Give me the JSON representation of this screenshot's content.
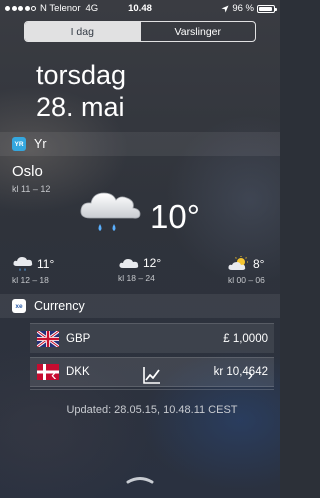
{
  "status_bar": {
    "carrier": "N Telenor",
    "network": "4G",
    "time": "10.48",
    "battery_percent": "96 %",
    "battery_level": 0.96
  },
  "tabs": [
    {
      "label": "I dag",
      "active": true
    },
    {
      "label": "Varslinger",
      "active": false
    }
  ],
  "today": {
    "weekday": "torsdag",
    "date": "28. mai"
  },
  "yr": {
    "app_name": "Yr",
    "app_icon_text": "YR",
    "city": "Oslo",
    "period": "kl 11 – 12",
    "current_temp": "10°",
    "current_icon": "cloud-rain-icon",
    "forecast": [
      {
        "temp": "11°",
        "time": "kl 12 – 18",
        "icon": "cloud-rain-icon"
      },
      {
        "temp": "12°",
        "time": "kl 18 – 24",
        "icon": "cloud-icon"
      },
      {
        "temp": "8°",
        "time": "kl 00 – 06",
        "icon": "sun-cloud-icon"
      }
    ]
  },
  "currency": {
    "app_name": "Currency",
    "app_icon_text": "xe",
    "rows": [
      {
        "code": "GBP",
        "value": "£ 1,0000",
        "flag": "uk-flag-icon"
      },
      {
        "code": "DKK",
        "value": "kr 10,4642",
        "flag": "denmark-flag-icon"
      }
    ],
    "prev_label": "‹",
    "next_label": "›",
    "updated": "Updated: 28.05.15, 10.48.11 CEST"
  },
  "colors": {
    "background": "#2c3038",
    "yr_icon": "#34a7df",
    "rain_drop": "#5ab0ff",
    "sun": "#f5c531"
  }
}
